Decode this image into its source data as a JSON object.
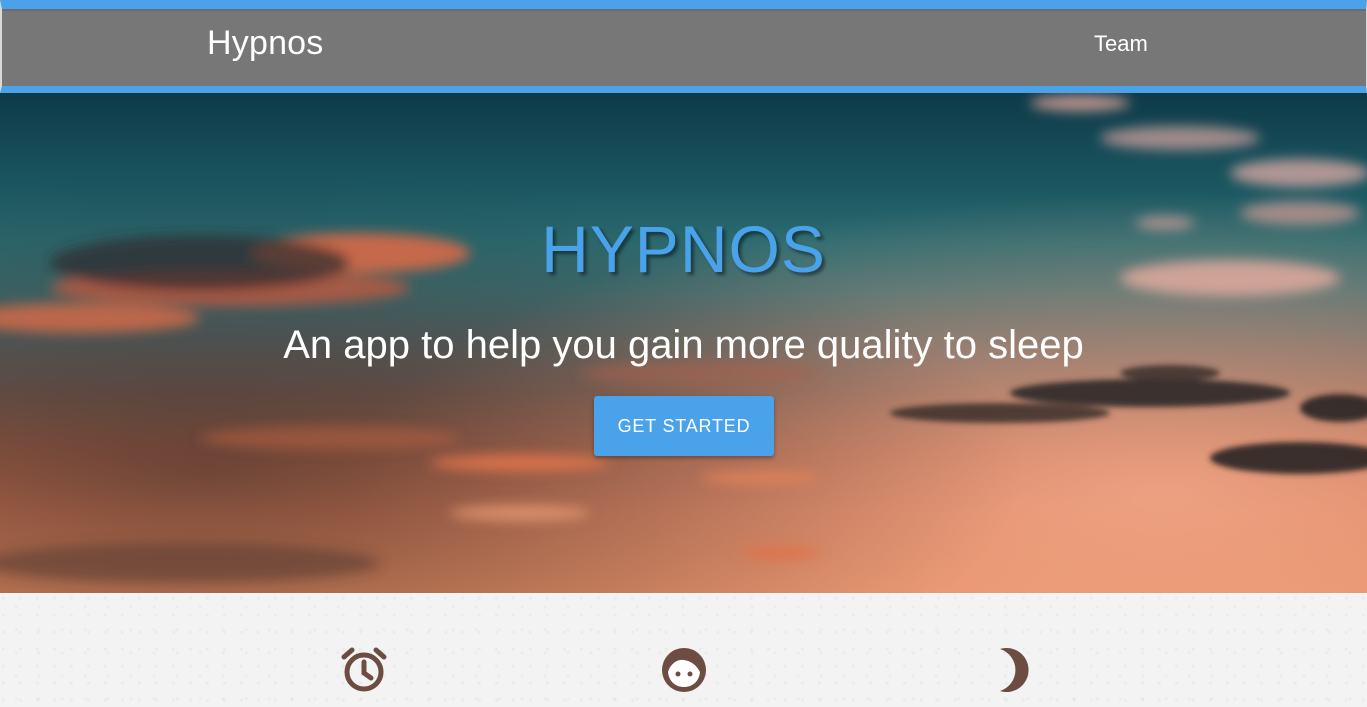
{
  "navbar": {
    "brand": "Hypnos",
    "links": [
      {
        "label": "Team"
      }
    ]
  },
  "hero": {
    "title": "HYPNOS",
    "subtitle": "An app to help you gain more quality to sleep",
    "cta_label": "GET STARTED"
  },
  "features": {
    "icons": [
      "alarm-clock-icon",
      "face-icon",
      "moon-icon"
    ]
  },
  "colors": {
    "accent": "#4aa3ea",
    "navbar_bg": "#777777",
    "icon_brown": "#6d4c41",
    "features_bg": "#f3f3f3"
  }
}
